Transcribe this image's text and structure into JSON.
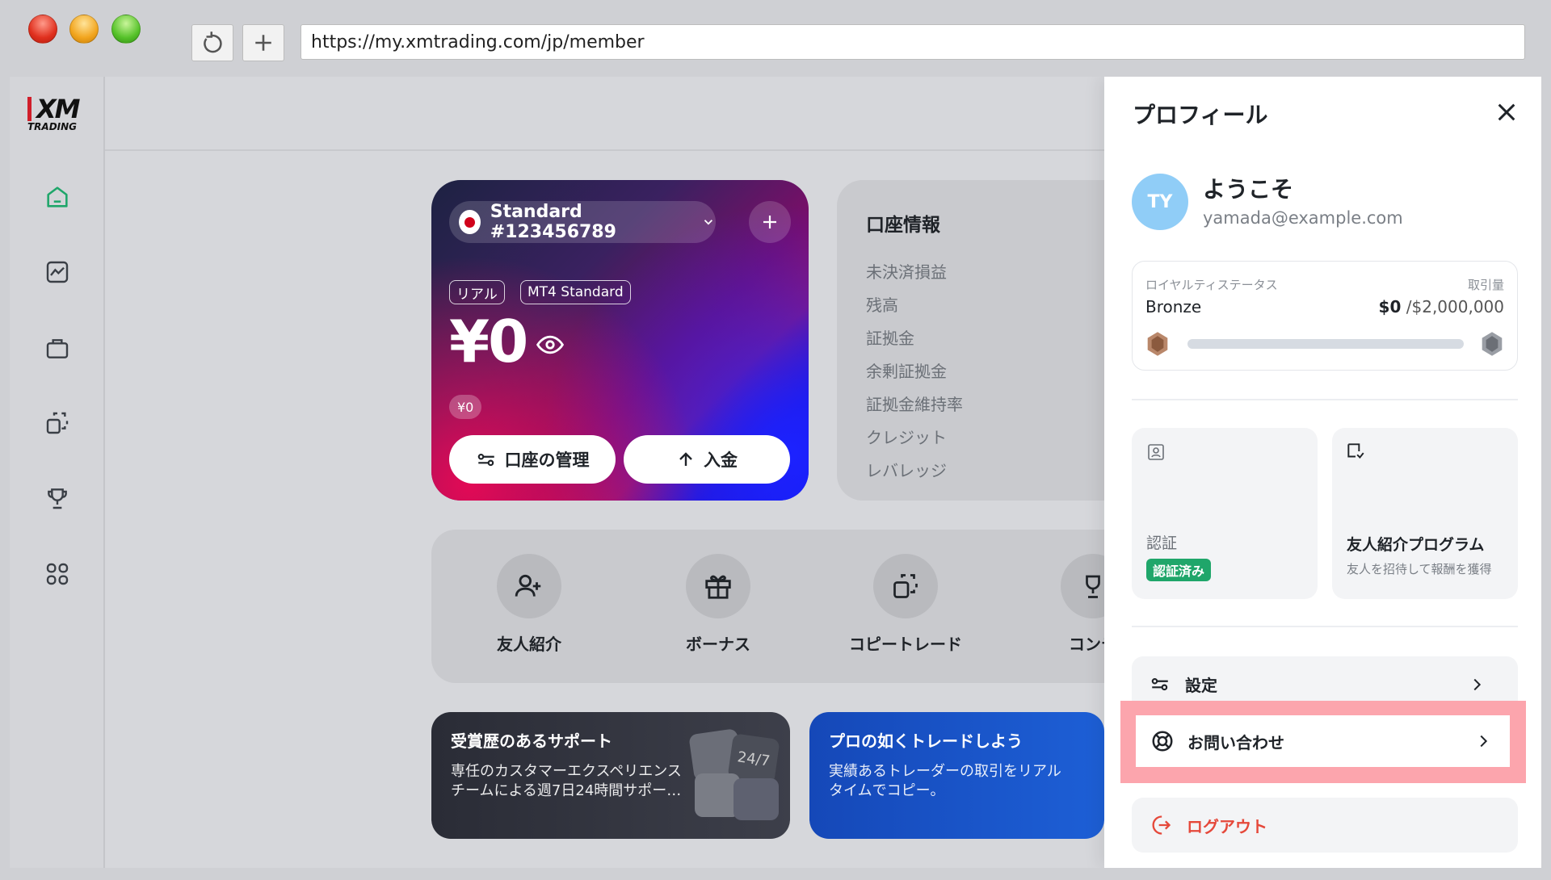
{
  "browser": {
    "url": "https://my.xmtrading.com/jp/member"
  },
  "logo": {
    "brand": "XM",
    "sub": "TRADING"
  },
  "account_card": {
    "account_label": "Standard #123456789",
    "tag_real": "リアル",
    "tag_platform": "MT4 Standard",
    "balance": "¥0",
    "sub_balance": "¥0",
    "manage_label": "口座の管理",
    "deposit_label": "入金"
  },
  "account_info": {
    "title": "口座情報",
    "rows": [
      "未決済損益",
      "残高",
      "証拠金",
      "余剰証拠金",
      "証拠金維持率",
      "クレジット",
      "レバレッジ"
    ]
  },
  "actions": [
    "友人紹介",
    "ボーナス",
    "コピートレード",
    "コンテ"
  ],
  "promos": [
    {
      "title": "受賞歴のあるサポート",
      "line1": "専任のカスタマーエクスペリエンス",
      "line2": "チームによる週7日24時間サポー…"
    },
    {
      "title": "プロの如くトレードしよう",
      "line1": "実績あるトレーダーの取引をリアル",
      "line2": "タイムでコピー。"
    }
  ],
  "profile": {
    "title": "プロフィール",
    "initials": "TY",
    "welcome": "ようこそ",
    "email": "yamada@example.com",
    "loyalty": {
      "label": "ロイヤルティステータス",
      "volume_label": "取引量",
      "tier": "Bronze",
      "current": "$0",
      "target": "/$2,000,000",
      "progress": 0
    },
    "verification": {
      "label": "認証",
      "status": "認証済み"
    },
    "referral": {
      "label": "友人紹介プログラム",
      "desc": "友人を招待して報酬を獲得"
    },
    "settings_label": "設定",
    "contact_label": "お問い合わせ",
    "logout_label": "ログアウト"
  },
  "colors": {
    "accent_green": "#1fa66a",
    "logout_red": "#e5483a",
    "highlight": "#fca5ad"
  }
}
